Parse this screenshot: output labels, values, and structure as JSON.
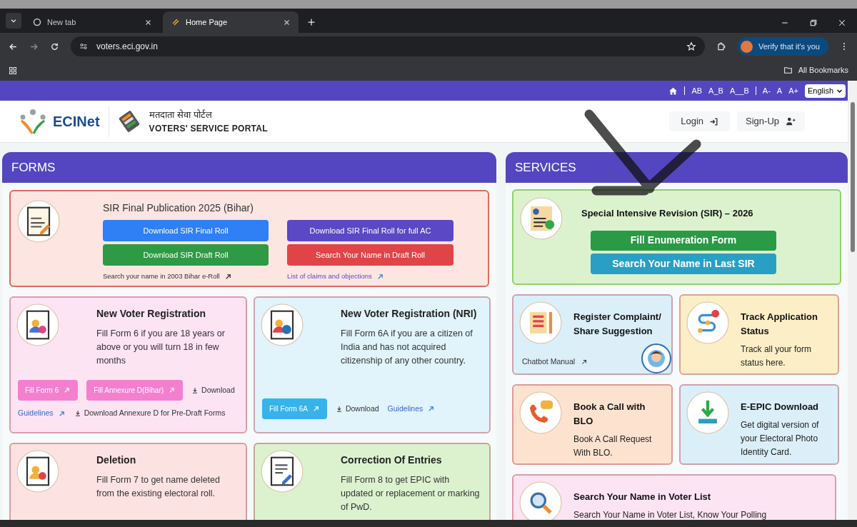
{
  "browser": {
    "tabs": [
      {
        "title": "New tab",
        "selected": false
      },
      {
        "title": "Home Page",
        "selected": true
      }
    ],
    "address": "voters.eci.gov.in",
    "profile_button": "Verify that it's you",
    "bookmarks": "All Bookmarks"
  },
  "utility_bar": {
    "text_styles": [
      "AB",
      "A_B",
      "A__B"
    ],
    "font_sizes": [
      "A-",
      "A",
      "A+"
    ],
    "language": "English"
  },
  "header": {
    "logo": "ECINet",
    "portal_hindi": "मतदाता सेवा पोर्टल",
    "portal_english": "VOTERS' SERVICE PORTAL",
    "login": "Login",
    "signup": "Sign-Up"
  },
  "forms": {
    "title": "FORMS",
    "sir_card": {
      "title": "SIR Final Publication 2025 (Bihar)",
      "buttons": [
        {
          "label": "Download SIR Final Roll",
          "color": "#2f7ff5"
        },
        {
          "label": "Download SIR Final Roll for full AC",
          "color": "#5a48c4"
        },
        {
          "label": "Download SIR Draft Roll",
          "color": "#2e9a45"
        },
        {
          "label": "Search Your Name in Draft Roll",
          "color": "#e04448"
        }
      ],
      "links": [
        {
          "label": "Search your name in 2003 Bihar e-Roll",
          "kind": "plain"
        },
        {
          "label": "List of claims and objections",
          "kind": "accent"
        }
      ]
    },
    "cards": [
      {
        "kind": "form-add",
        "color": "#fde4f3",
        "title": "New Voter Registration",
        "text": "Fill Form 6 if you are 18 years or above or you will turn 18 in few months",
        "actions": [
          {
            "kind": "button",
            "label": "Fill Form 6",
            "color": "#f57fcf"
          },
          {
            "kind": "button",
            "label": "Fill Annexure D(Bihar)",
            "color": "#f57fcf"
          },
          {
            "kind": "download",
            "label": "Download"
          },
          {
            "kind": "link",
            "label": "Guidelines"
          },
          {
            "kind": "download",
            "label": "Download Annexure D for Pre-Draft Forms"
          }
        ]
      },
      {
        "kind": "form-globe",
        "color": "#e1f3fb",
        "title": "New Voter Registration (NRI)",
        "text": "Fill Form 6A if you are a citizen of India and has not acquired citizenship of any other country.",
        "actions": [
          {
            "kind": "button",
            "label": "Fill Form 6A",
            "color": "#35b3ea"
          },
          {
            "kind": "download",
            "label": "Download"
          },
          {
            "kind": "link",
            "label": "Guidelines"
          }
        ]
      },
      {
        "kind": "form-remove",
        "color": "#fce3e1",
        "title": "Deletion",
        "text": "Fill Form 7 to get name deleted from the existing electoral roll."
      },
      {
        "kind": "form-edit",
        "color": "#dcf2cf",
        "title": "Correction Of Entries",
        "text": "Fill Form 8 to get EPIC with updated or replacement or marking of PwD."
      }
    ]
  },
  "services": {
    "title": "SERVICES",
    "sir_card": {
      "title": "Special Intensive Revision (SIR) – 2026",
      "buttons": [
        {
          "label": "Fill Enumeration Form",
          "color": "#2a9a45"
        },
        {
          "label": "Search Your Name in Last SIR",
          "color": "#2a9fc4"
        }
      ]
    },
    "cards": [
      {
        "kind": "complaint",
        "color": "#dbeff9",
        "title": "Register Complaint/ Share Suggestion",
        "link": "Chatbot Manual"
      },
      {
        "kind": "route",
        "color": "#fcefc7",
        "title": "Track Application Status",
        "text": "Track all your form status here."
      },
      {
        "kind": "phone",
        "color": "#fde3cf",
        "title": "Book a Call with BLO",
        "text": "Book A Call Request With BLO."
      },
      {
        "kind": "download",
        "color": "#dbeff9",
        "title": "E-EPIC Download",
        "text": "Get digital version of your Electoral Photo Identity Card."
      },
      {
        "kind": "search",
        "color": "#fce4f3",
        "title": "Search Your Name in Voter List",
        "text": "Search Your Name in Voter List, Know Your Polling",
        "wide": true
      }
    ]
  }
}
